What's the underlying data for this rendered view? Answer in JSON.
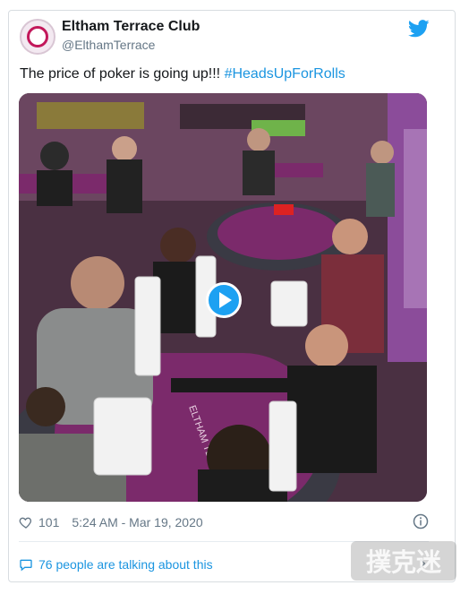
{
  "account": {
    "name": "Eltham Terrace Club",
    "handle": "@ElthamTerrace",
    "avatar_icon": "club-logo-icon"
  },
  "tweet": {
    "text": "The price of poker is going up!!! ",
    "hashtag": "#HeadsUpForRolls"
  },
  "media": {
    "type": "video",
    "play_icon": "play-icon",
    "table_lettering": "ELTHAM TERRACE CLUB"
  },
  "footer": {
    "likes": "101",
    "timestamp": "5:24 AM - Mar 19, 2020",
    "conversation": "76 people are talking about this"
  },
  "colors": {
    "link": "#1b95e0",
    "brand": "#1da1f2",
    "text": "#14171a",
    "muted": "#657786",
    "felt": "#7b2a6b"
  },
  "watermark": {
    "text": "撲克迷"
  }
}
